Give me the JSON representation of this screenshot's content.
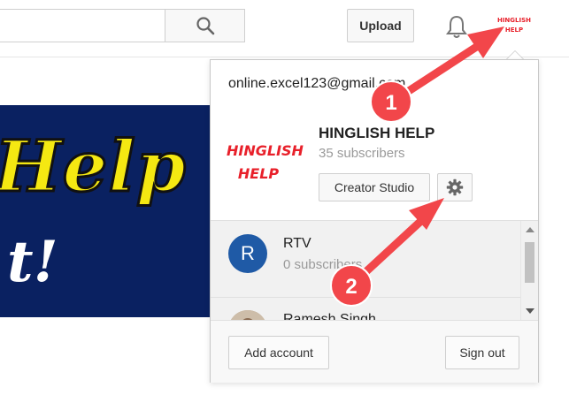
{
  "header": {
    "search_placeholder": "",
    "upload_label": "Upload",
    "logo_line1": "HINGLISH",
    "logo_line2": "HELP"
  },
  "banner": {
    "text1": "Help",
    "text2": "t!"
  },
  "account_menu": {
    "email": "online.excel123@gmail.com",
    "channel_logo_line1": "HINGLISH",
    "channel_logo_line2": "HELP",
    "channel_name": "HINGLISH HELP",
    "channel_subscribers": "35 subscribers",
    "creator_studio_label": "Creator Studio",
    "accounts": [
      {
        "avatar_letter": "R",
        "name": "RTV",
        "subscribers": "0 subscribers"
      },
      {
        "name": "Ramesh Singh"
      }
    ],
    "add_account_label": "Add account",
    "sign_out_label": "Sign out"
  },
  "annotations": [
    {
      "number": "1"
    },
    {
      "number": "2"
    }
  ],
  "colors": {
    "annotation_red": "#f2464a",
    "brand_red": "#e8202a",
    "banner_blue": "#0a2161",
    "banner_yellow": "#f5e812",
    "avatar_blue": "#1f5aa6"
  }
}
